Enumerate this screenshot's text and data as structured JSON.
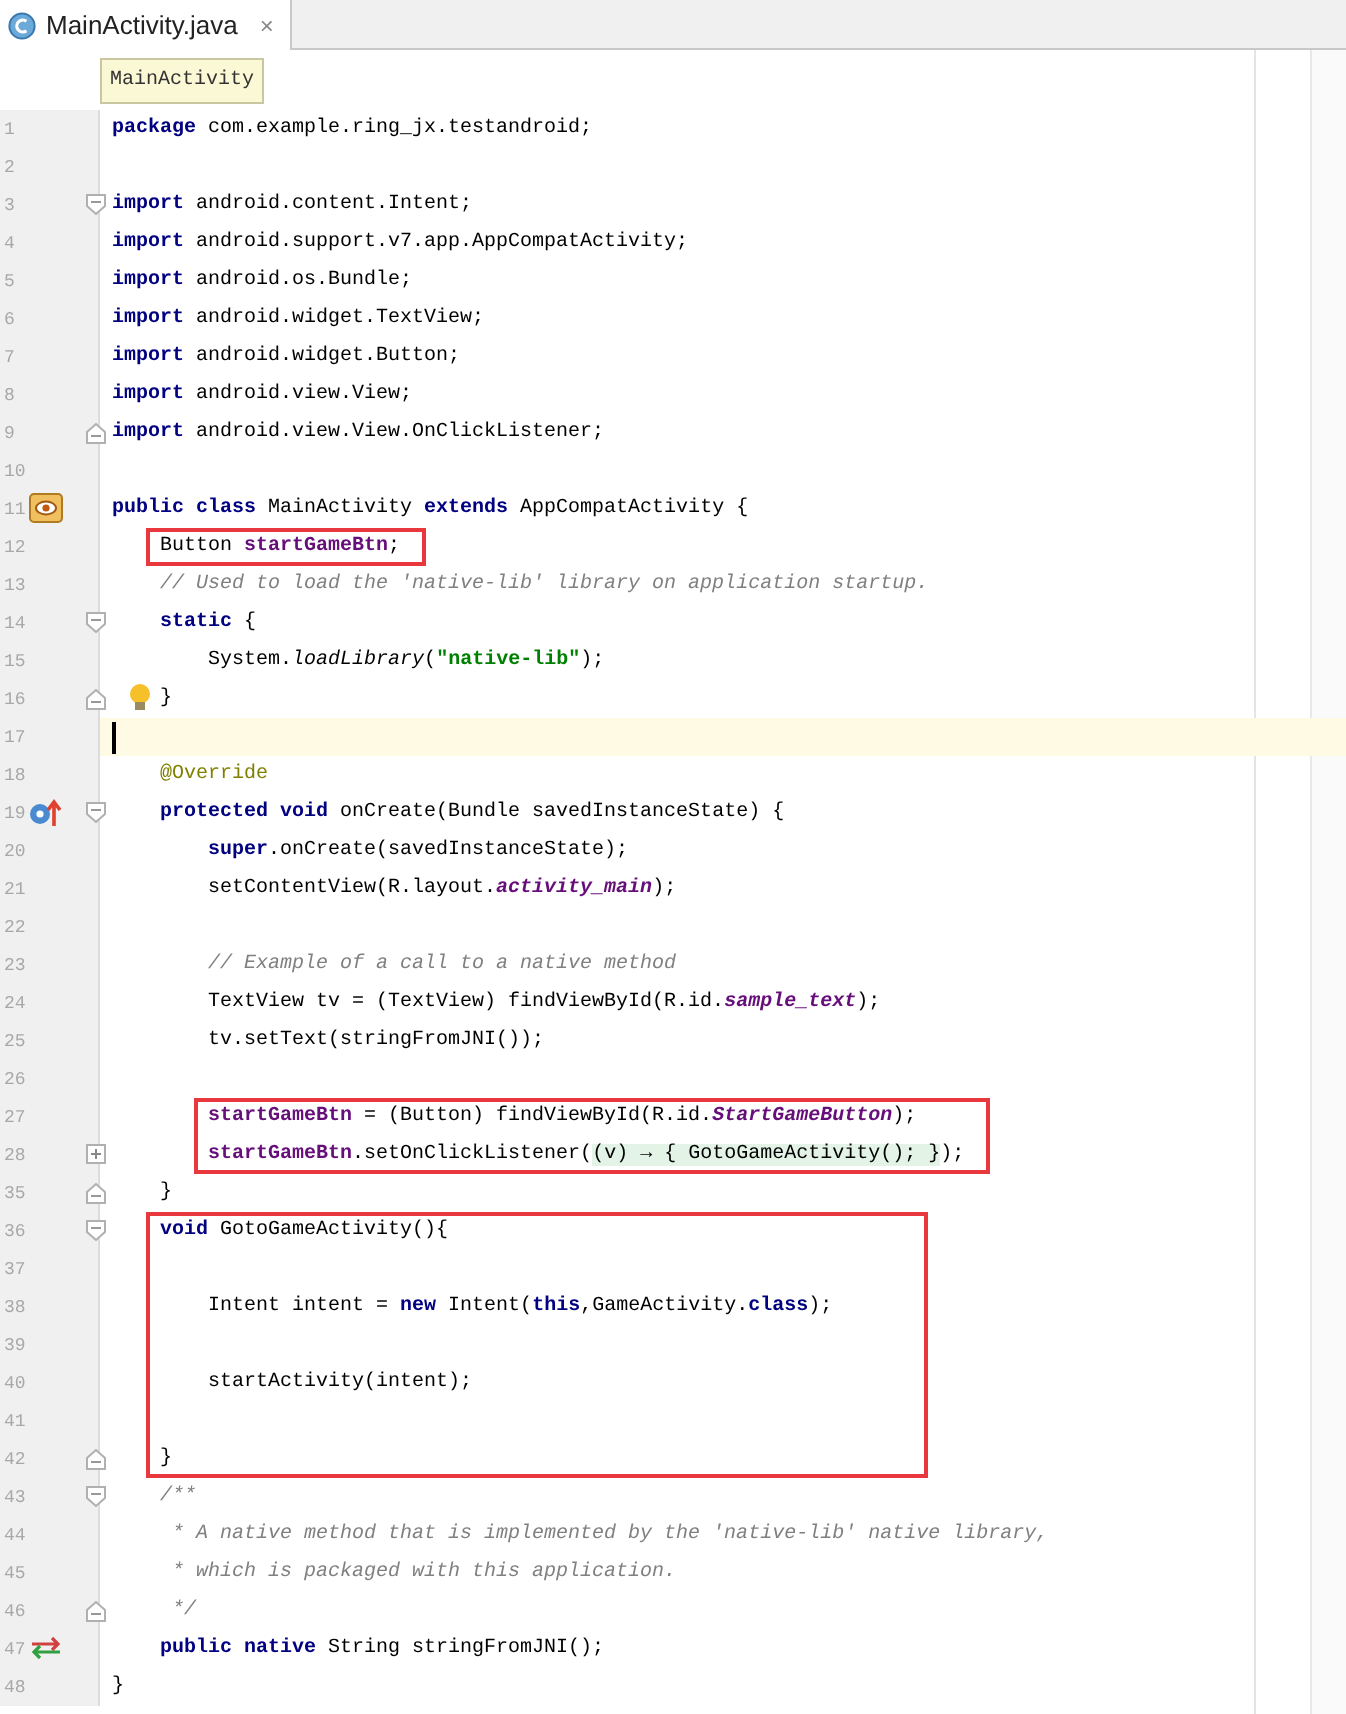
{
  "tab": {
    "title": "MainActivity.java",
    "close": "×",
    "selected": true
  },
  "breadcrumb": {
    "label": "MainActivity"
  },
  "blocks": [
    {
      "highlighted": false,
      "lines": [
        {
          "number": "1",
          "segments": [
            {
              "kind": "keyword",
              "text": "package"
            },
            {
              "kind": "plain",
              "text": " com.example.ring_jx.testandroid;"
            }
          ]
        },
        {
          "number": "2"
        },
        {
          "number": "3",
          "fold": {
            "kind": "open"
          },
          "segments": [
            {
              "kind": "keyword",
              "text": "import"
            },
            {
              "kind": "plain",
              "text": " android.content.Intent;"
            }
          ]
        },
        {
          "number": "4",
          "segments": [
            {
              "kind": "keyword",
              "text": "import"
            },
            {
              "kind": "plain",
              "text": " android.support.v7.app.AppCompatActivity;"
            }
          ]
        },
        {
          "number": "5",
          "segments": [
            {
              "kind": "keyword",
              "text": "import"
            },
            {
              "kind": "plain",
              "text": " android.os.Bundle;"
            }
          ]
        },
        {
          "number": "6",
          "segments": [
            {
              "kind": "keyword",
              "text": "import"
            },
            {
              "kind": "plain",
              "text": " android.widget.TextView;"
            }
          ]
        },
        {
          "number": "7",
          "segments": [
            {
              "kind": "keyword",
              "text": "import"
            },
            {
              "kind": "plain",
              "text": " android.widget.Button;"
            }
          ]
        },
        {
          "number": "8",
          "segments": [
            {
              "kind": "keyword",
              "text": "import"
            },
            {
              "kind": "plain",
              "text": " android.view.View;"
            }
          ]
        },
        {
          "number": "9",
          "fold": {
            "kind": "close"
          },
          "segments": [
            {
              "kind": "keyword",
              "text": "import"
            },
            {
              "kind": "plain",
              "text": " android.view.View.OnClickListener;"
            }
          ]
        },
        {
          "number": "10"
        },
        {
          "number": "11",
          "gutter_icon": {
            "kind": "class"
          },
          "segments": [
            {
              "kind": "keyword",
              "text": "public class"
            },
            {
              "kind": "plain",
              "text": " MainActivity "
            },
            {
              "kind": "keyword",
              "text": "extends"
            },
            {
              "kind": "plain",
              "text": " AppCompatActivity {"
            }
          ]
        }
      ]
    },
    {
      "highlighted": true,
      "lines": [
        {
          "number": "12",
          "segments": [
            {
              "kind": "plain",
              "text": "    Button "
            },
            {
              "kind": "field",
              "text": "startGameBtn"
            },
            {
              "kind": "plain",
              "text": ";"
            }
          ]
        }
      ]
    },
    {
      "highlighted": false,
      "lines": [
        {
          "number": "13",
          "segments": [
            {
              "kind": "comment",
              "text": "    // Used to load the 'native-lib' library on application startup."
            }
          ]
        },
        {
          "number": "14",
          "fold": {
            "kind": "open"
          },
          "segments": [
            {
              "kind": "keyword",
              "text": "    static"
            },
            {
              "kind": "plain",
              "text": " {"
            }
          ]
        },
        {
          "number": "15",
          "segments": [
            {
              "kind": "plain",
              "text": "        System."
            },
            {
              "kind": "static-method",
              "text": "loadLibrary"
            },
            {
              "kind": "plain",
              "text": "("
            },
            {
              "kind": "string",
              "text": "\"native-lib\""
            },
            {
              "kind": "plain",
              "text": ");"
            }
          ]
        },
        {
          "number": "16",
          "fold": {
            "kind": "close"
          },
          "gutter_icon": {
            "kind": "bulb"
          },
          "segments": [
            {
              "kind": "plain",
              "text": "    }"
            }
          ]
        },
        {
          "number": "17",
          "current": true
        },
        {
          "number": "18",
          "segments": [
            {
              "kind": "annotation",
              "text": "    @Override"
            }
          ]
        },
        {
          "number": "19",
          "fold": {
            "kind": "open"
          },
          "gutter_icon": {
            "kind": "override"
          },
          "segments": [
            {
              "kind": "keyword",
              "text": "    protected void"
            },
            {
              "kind": "plain",
              "text": " onCreate(Bundle savedInstanceState) {"
            }
          ]
        },
        {
          "number": "20",
          "segments": [
            {
              "kind": "keyword",
              "text": "        super"
            },
            {
              "kind": "plain",
              "text": ".onCreate(savedInstanceState);"
            }
          ]
        },
        {
          "number": "21",
          "segments": [
            {
              "kind": "plain",
              "text": "        setContentView(R.layout."
            },
            {
              "kind": "static-field",
              "text": "activity_main"
            },
            {
              "kind": "plain",
              "text": ");"
            }
          ]
        },
        {
          "number": "22"
        },
        {
          "number": "23",
          "segments": [
            {
              "kind": "comment",
              "text": "        // Example of a call to a native method"
            }
          ]
        },
        {
          "number": "24",
          "segments": [
            {
              "kind": "plain",
              "text": "        TextView tv = (TextView) findViewById(R.id."
            },
            {
              "kind": "static-field",
              "text": "sample_text"
            },
            {
              "kind": "plain",
              "text": ");"
            }
          ]
        },
        {
          "number": "25",
          "segments": [
            {
              "kind": "plain",
              "text": "        tv.setText(stringFromJNI());"
            }
          ]
        },
        {
          "number": "26"
        }
      ]
    },
    {
      "highlighted": true,
      "lines": [
        {
          "number": "27",
          "segments": [
            {
              "kind": "field",
              "text": "        startGameBtn"
            },
            {
              "kind": "plain",
              "text": " = (Button) findViewById(R.id."
            },
            {
              "kind": "static-field",
              "text": "StartGameButton"
            },
            {
              "kind": "plain",
              "text": ");"
            }
          ]
        },
        {
          "number": "28",
          "fold": {
            "kind": "collapsed"
          },
          "segments": [
            {
              "kind": "field",
              "text": "        startGameBtn"
            },
            {
              "kind": "plain",
              "text": ".setOnClickListener("
            },
            {
              "kind": "folded",
              "text": "(v) → { GotoGameActivity(); }"
            },
            {
              "kind": "plain",
              "text": ");"
            }
          ]
        }
      ]
    },
    {
      "highlighted": false,
      "lines": [
        {
          "number": "35",
          "fold": {
            "kind": "close"
          },
          "segments": [
            {
              "kind": "plain",
              "text": "    }"
            }
          ]
        }
      ]
    },
    {
      "highlighted": true,
      "lines": [
        {
          "number": "36",
          "fold": {
            "kind": "open"
          },
          "segments": [
            {
              "kind": "keyword",
              "text": "    void"
            },
            {
              "kind": "plain",
              "text": " GotoGameActivity(){"
            }
          ]
        },
        {
          "number": "37"
        },
        {
          "number": "38",
          "segments": [
            {
              "kind": "plain",
              "text": "        Intent intent = "
            },
            {
              "kind": "keyword",
              "text": "new"
            },
            {
              "kind": "plain",
              "text": " Intent("
            },
            {
              "kind": "keyword",
              "text": "this"
            },
            {
              "kind": "plain",
              "text": ",GameActivity."
            },
            {
              "kind": "keyword",
              "text": "class"
            },
            {
              "kind": "plain",
              "text": ");"
            }
          ]
        },
        {
          "number": "39"
        },
        {
          "number": "40",
          "segments": [
            {
              "kind": "plain",
              "text": "        startActivity(intent);"
            }
          ]
        },
        {
          "number": "41"
        },
        {
          "number": "42",
          "fold": {
            "kind": "close"
          },
          "segments": [
            {
              "kind": "plain",
              "text": "    }"
            }
          ]
        }
      ]
    },
    {
      "highlighted": false,
      "lines": [
        {
          "number": "43",
          "fold": {
            "kind": "open"
          },
          "segments": [
            {
              "kind": "comment",
              "text": "    /**"
            }
          ]
        },
        {
          "number": "44",
          "segments": [
            {
              "kind": "comment",
              "text": "     * A native method that is implemented by the 'native-lib' native library,"
            }
          ]
        },
        {
          "number": "45",
          "segments": [
            {
              "kind": "comment",
              "text": "     * which is packaged with this application."
            }
          ]
        },
        {
          "number": "46",
          "fold": {
            "kind": "close"
          },
          "segments": [
            {
              "kind": "comment",
              "text": "     */"
            }
          ]
        },
        {
          "number": "47",
          "gutter_icon": {
            "kind": "native"
          },
          "segments": [
            {
              "kind": "keyword",
              "text": "    public native"
            },
            {
              "kind": "plain",
              "text": " String stringFromJNI();"
            }
          ]
        },
        {
          "number": "48",
          "segments": [
            {
              "kind": "plain",
              "text": "}"
            }
          ]
        }
      ]
    }
  ]
}
